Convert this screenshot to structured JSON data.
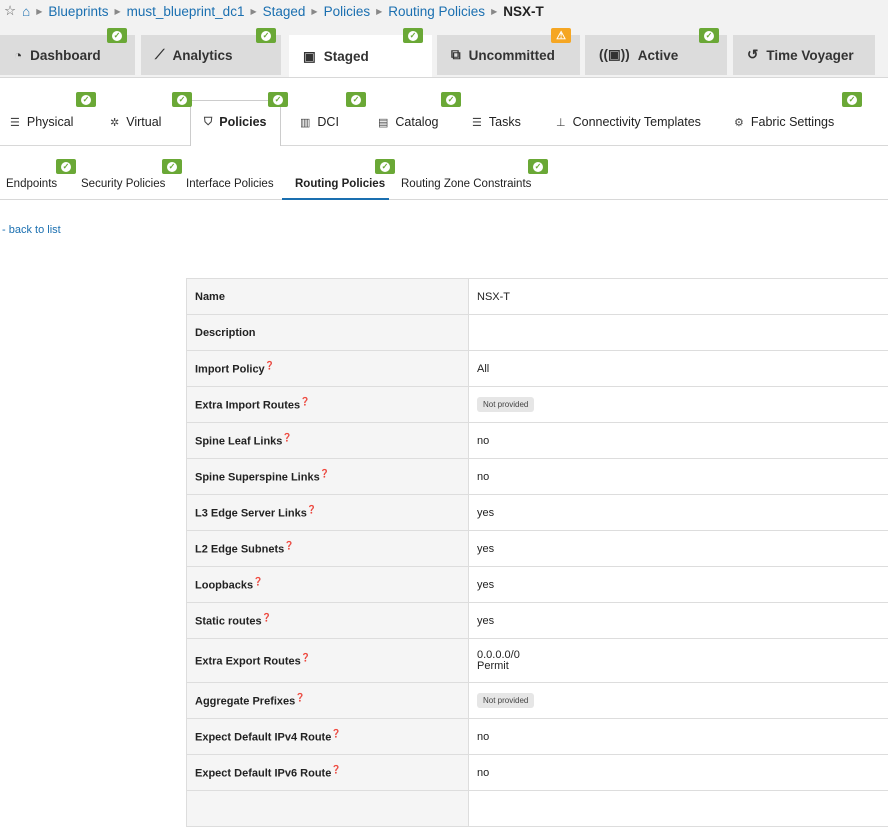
{
  "breadcrumb": [
    "Blueprints",
    "must_blueprint_dc1",
    "Staged",
    "Policies",
    "Routing Policies"
  ],
  "breadcrumb_current": "NSX-T",
  "top_tabs": [
    {
      "label": "Dashboard",
      "icon": "gauge-icon",
      "status": "ok"
    },
    {
      "label": "Analytics",
      "icon": "chart-line-icon",
      "status": "ok"
    },
    {
      "label": "Staged",
      "icon": "file-lock-icon",
      "status": "ok",
      "active": true
    },
    {
      "label": "Uncommitted",
      "icon": "diff-icon",
      "status": "warning"
    },
    {
      "label": "Active",
      "icon": "broadcast-icon",
      "status": "ok"
    },
    {
      "label": "Time Voyager",
      "icon": "history-icon"
    }
  ],
  "sub_tabs": [
    {
      "label": "Physical",
      "icon": "server-icon"
    },
    {
      "label": "Virtual",
      "icon": "network-icon"
    },
    {
      "label": "Policies",
      "icon": "shield-icon",
      "active": true
    },
    {
      "label": "DCI",
      "icon": "dci-icon"
    },
    {
      "label": "Catalog",
      "icon": "catalog-icon"
    },
    {
      "label": "Tasks",
      "icon": "list-icon"
    },
    {
      "label": "Connectivity Templates",
      "icon": "sitemap-icon"
    },
    {
      "label": "Fabric Settings",
      "icon": "settings-icon"
    }
  ],
  "policy_tabs": [
    "Endpoints",
    "Security Policies",
    "Interface Policies",
    "Routing Policies",
    "Routing Zone Constraints"
  ],
  "back_link": "back to list",
  "not_provided": "Not provided",
  "rows": [
    {
      "k": "Name",
      "v": "NSX-T"
    },
    {
      "k": "Description",
      "v": ""
    },
    {
      "k": "Import Policy",
      "v": "All",
      "help": true
    },
    {
      "k": "Extra Import Routes",
      "v": "Not provided",
      "help": true
    },
    {
      "k": "Spine Leaf Links",
      "v": "no",
      "help": true
    },
    {
      "k": "Spine Superspine Links",
      "v": "no",
      "help": true
    },
    {
      "k": "L3 Edge Server Links",
      "v": "yes",
      "help": true
    },
    {
      "k": "L2 Edge Subnets",
      "v": "yes",
      "help": true
    },
    {
      "k": "Loopbacks",
      "v": "yes",
      "help": true
    },
    {
      "k": "Static routes",
      "v": "yes",
      "help": true
    },
    {
      "k": "Extra Export Routes",
      "v": "0.0.0.0/0",
      "v2": "Permit",
      "help": true
    },
    {
      "k": "Aggregate Prefixes",
      "v": "Not provided",
      "help": true
    },
    {
      "k": "Expect Default IPv4 Route",
      "v": "no",
      "help": true
    },
    {
      "k": "Expect Default IPv6 Route",
      "v": "no",
      "help": true
    }
  ]
}
